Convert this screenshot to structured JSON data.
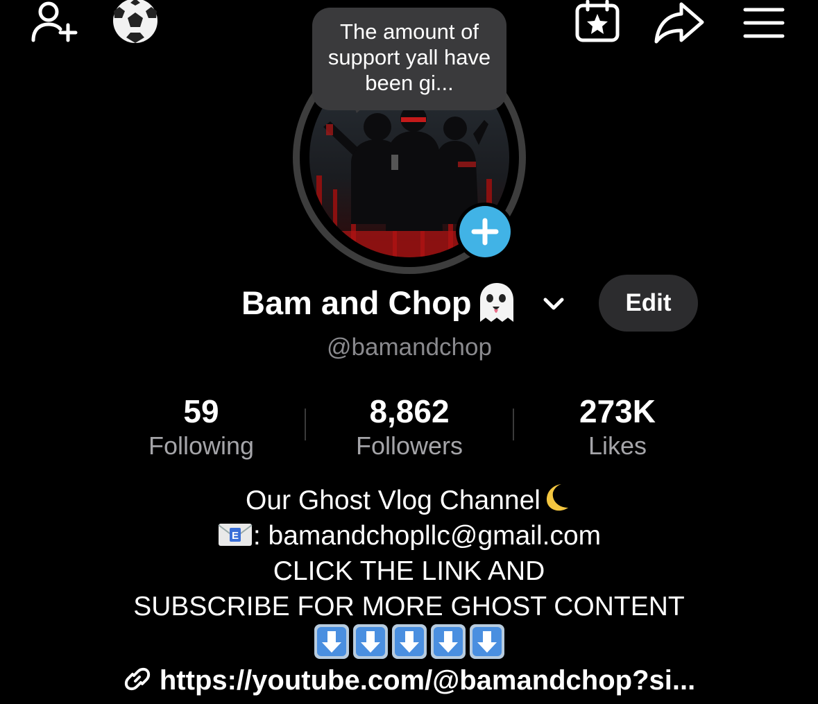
{
  "top_bar": {
    "add_friend_icon": "person-add-icon",
    "soccer_icon": "soccer-ball-icon",
    "calendar_icon": "calendar-star-icon",
    "share_icon": "share-arrow-icon",
    "menu_icon": "hamburger-menu-icon"
  },
  "note": {
    "text": "The amount of support yall have been gi..."
  },
  "profile": {
    "name": "Bam and Chop",
    "handle": "@bamandchop",
    "edit_label": "Edit"
  },
  "stats": {
    "following": {
      "value": "59",
      "label": "Following"
    },
    "followers": {
      "value": "8,862",
      "label": "Followers"
    },
    "likes": {
      "value": "273K",
      "label": "Likes"
    }
  },
  "bio": {
    "line1": "Our Ghost Vlog Channel",
    "line2": ": bamandchopllc@gmail.com",
    "line3": "CLICK THE LINK AND",
    "line4": "SUBSCRIBE FOR MORE GHOST CONTENT"
  },
  "link": {
    "text": "https://youtube.com/@bamandchop?si..."
  },
  "colors": {
    "background": "#000000",
    "story_button": "#41b3e6",
    "secondary_text": "#8a8a8e",
    "edit_button": "#2c2c2e"
  }
}
